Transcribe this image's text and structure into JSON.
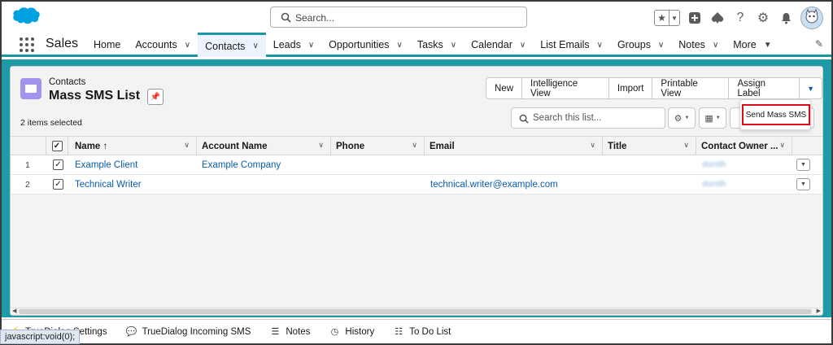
{
  "header": {
    "search_placeholder": "Search...",
    "colors": {
      "brand": "#00a1e0",
      "accent": "#1b96a5"
    }
  },
  "nav": {
    "app_name": "Sales",
    "items": [
      {
        "label": "Home",
        "chevron": false
      },
      {
        "label": "Accounts",
        "chevron": true
      },
      {
        "label": "Contacts",
        "chevron": true,
        "active": true
      },
      {
        "label": "Leads",
        "chevron": true
      },
      {
        "label": "Opportunities",
        "chevron": true
      },
      {
        "label": "Tasks",
        "chevron": true
      },
      {
        "label": "Calendar",
        "chevron": true
      },
      {
        "label": "List Emails",
        "chevron": true
      },
      {
        "label": "Groups",
        "chevron": true
      },
      {
        "label": "Notes",
        "chevron": true
      },
      {
        "label": "More",
        "chevron": true
      }
    ]
  },
  "list": {
    "object_label": "Contacts",
    "view_name": "Mass SMS List",
    "selected_text": "2 items selected",
    "actions": [
      "New",
      "Intelligence View",
      "Import",
      "Printable View",
      "Assign Label"
    ],
    "search_placeholder": "Search this list...",
    "dropdown_item": "Send Mass SMS"
  },
  "table": {
    "columns": [
      "Name ↑",
      "Account Name",
      "Phone",
      "Email",
      "Title",
      "Contact Owner ..."
    ],
    "rows": [
      {
        "num": "1",
        "name": "Example Client",
        "account": "Example Company",
        "phone": "",
        "email": "",
        "title": "",
        "owner": "dsmith"
      },
      {
        "num": "2",
        "name": "Technical Writer",
        "account": "",
        "phone": "",
        "email": "technical.writer@example.com",
        "title": "",
        "owner": "dsmith"
      }
    ]
  },
  "utility_bar": {
    "items": [
      "TrueDialog Settings",
      "TrueDialog Incoming SMS",
      "Notes",
      "History",
      "To Do List"
    ]
  },
  "status_bar": {
    "text": "javascript:void(0);"
  }
}
